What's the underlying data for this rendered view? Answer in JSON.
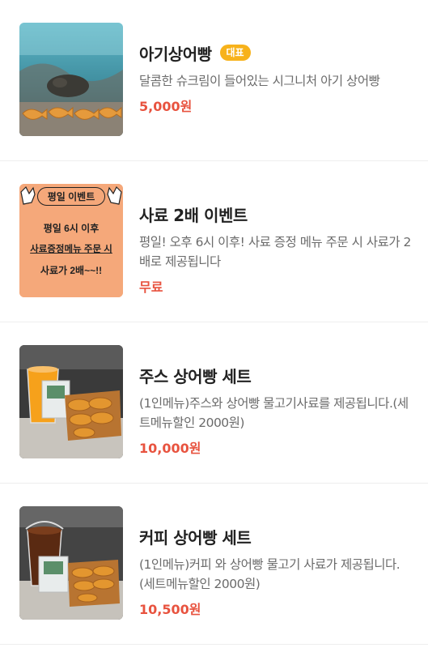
{
  "colors": {
    "price": "#e8533f",
    "badge": "#f7b21b",
    "title": "#222222",
    "desc": "#6b6b6b"
  },
  "items": [
    {
      "title": "아기상어빵",
      "badge": "대표",
      "description": "달콤한 슈크림이 들어있는 시그니처 아기 상어빵",
      "price": "5,000원"
    },
    {
      "title": "사료 2배 이벤트",
      "description": "평일! 오후 6시 이후! 사료 증정 메뉴 주문 시 사료가 2배로 제공됩니다",
      "price": "무료",
      "image_text": {
        "line1": "평일 이벤트",
        "line2": "평일 6시 이후",
        "line3": "사료증정메뉴 주문 시",
        "line4": "사료가 2배~~!!"
      }
    },
    {
      "title": "주스 상어빵 세트",
      "description": "(1인메뉴)주스와 상어빵 물고기사료를 제공됩니다.(세트메뉴할인 2000원)",
      "price": "10,000원"
    },
    {
      "title": "커피 상어빵 세트",
      "description": "(1인메뉴)커피 와 상어빵 물고기 사료가 제공됩니다.(세트메뉴할인 2000원)",
      "price": "10,500원"
    }
  ]
}
